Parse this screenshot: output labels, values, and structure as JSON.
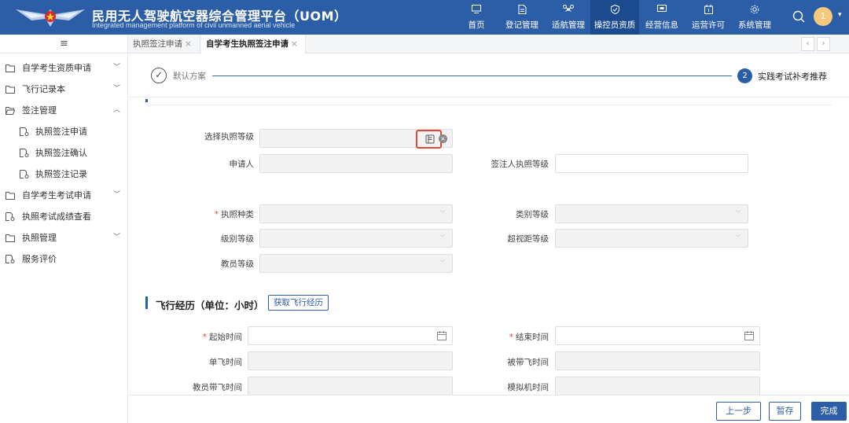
{
  "header": {
    "title": "民用无人驾驶航空器综合管理平台（UOM）",
    "subtitle": "Integrated management platform of civil unmanned aerial vehicle",
    "nav": [
      {
        "label": "首页",
        "icon": "monitor-icon"
      },
      {
        "label": "登记管理",
        "icon": "document-icon"
      },
      {
        "label": "适航管理",
        "icon": "drone-icon"
      },
      {
        "label": "操控员资质",
        "icon": "shield-icon",
        "active": true
      },
      {
        "label": "经营信息",
        "icon": "screen-icon"
      },
      {
        "label": "运营许可",
        "icon": "permit-icon"
      },
      {
        "label": "系统管理",
        "icon": "settings-icon"
      }
    ],
    "avatar_text": "1",
    "brand_color": "#2c5ea8"
  },
  "sidebar": {
    "items": [
      {
        "label": "自学考生资质申请",
        "arrow": "﹀"
      },
      {
        "label": "飞行记录本",
        "arrow": "﹀"
      },
      {
        "label": "签注管理",
        "arrow": "︿"
      },
      {
        "label": "执照签注申请"
      },
      {
        "label": "执照签注确认"
      },
      {
        "label": "执照签注记录"
      },
      {
        "label": "自学考生考试申请",
        "arrow": "﹀"
      },
      {
        "label": "执照考试成绩查看"
      },
      {
        "label": "执照管理",
        "arrow": "﹀"
      },
      {
        "label": "服务评价"
      }
    ]
  },
  "tabs": [
    {
      "label": "执照签注申请"
    },
    {
      "label": "自学考生执照签注申请",
      "active": true
    }
  ],
  "steps": {
    "step1": {
      "label": "默认方案"
    },
    "step2": {
      "number": "2",
      "label": "实践考试补考推荐"
    }
  },
  "form": {
    "license_level_label": "选择执照等级",
    "applicant_label": "申请人",
    "endorser_level_label": "签注人执照等级",
    "license_type_label": "执照种类",
    "category_level_label": "类别等级",
    "class_level_label": "级别等级",
    "bvlos_level_label": "超视距等级",
    "instructor_level_label": "教员等级",
    "required_mark": "*"
  },
  "flight": {
    "section_title": "飞行经历（单位：小时）",
    "fetch_button": "获取飞行经历",
    "start_time_label": "起始时间",
    "end_time_label": "结束时间",
    "solo_time_label": "单飞时间",
    "dual_time_label": "被带飞时间",
    "instructor_time_label": "教员带飞时间",
    "simulator_time_label": "模拟机时间"
  },
  "footer": {
    "prev_label": "上一步",
    "save_label": "暂存",
    "finish_label": "完成"
  }
}
